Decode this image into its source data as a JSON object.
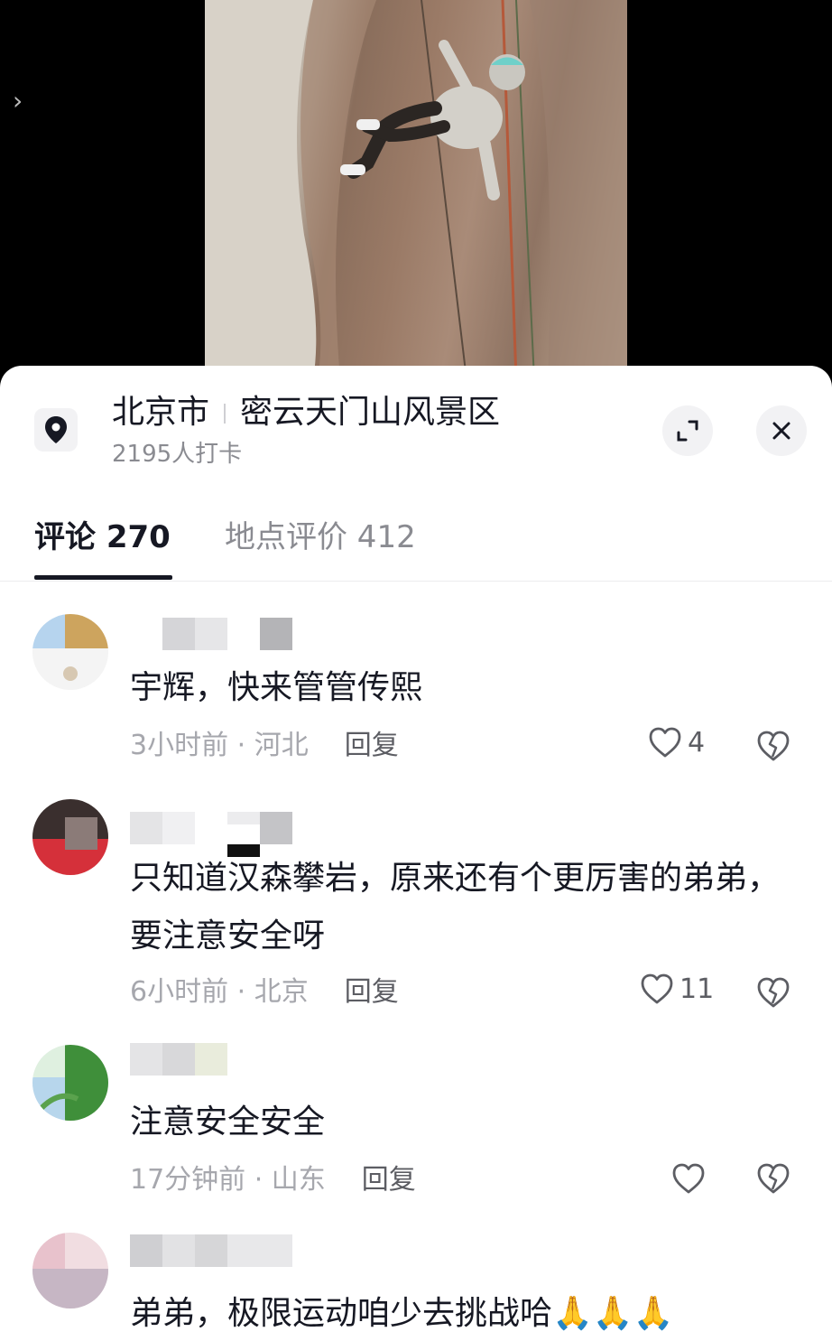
{
  "location": {
    "city": "北京市",
    "place": "密云天门山风景区",
    "checkins": "2195人打卡"
  },
  "tabs": [
    {
      "label": "评论 270"
    },
    {
      "label": "地点评价 412"
    }
  ],
  "comments": [
    {
      "text": "宇辉，快来管管传熙",
      "time": "3小时前 · 河北",
      "reply": "回复",
      "likes": "4"
    },
    {
      "text": "只知道汉森攀岩，原来还有个更厉害的弟弟，要注意安全呀",
      "time": "6小时前 · 北京",
      "reply": "回复",
      "likes": "11"
    },
    {
      "text": "注意安全安全",
      "time": "17分钟前 · 山东",
      "reply": "回复",
      "likes": ""
    },
    {
      "text": "弟弟，极限运动咱少去挑战哈🙏🙏🙏",
      "time": "",
      "reply": "",
      "likes": ""
    }
  ]
}
